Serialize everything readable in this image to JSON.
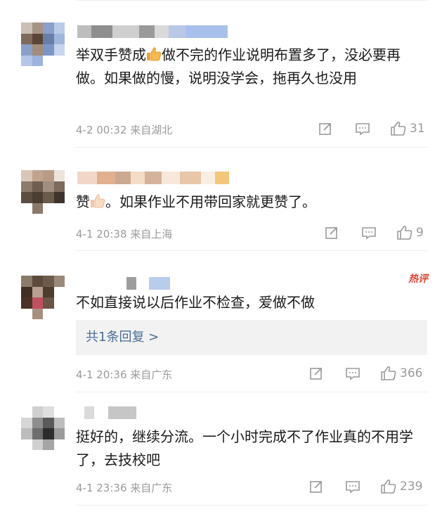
{
  "comments": [
    {
      "text": "举双手赞成👍做不完的作业说明布置多了，没必要再做。如果做的慢，说明没学会，拖再久也没用",
      "text_before": "举双手赞成",
      "text_after": "做不完的作业说明布置多了，没必要再做。如果做的慢，说明没学会，拖再久也没用",
      "time": "4-2 00:32 来自湖北",
      "likes": "31",
      "emoji": "thumbs-up-icon"
    },
    {
      "text_before": "赞",
      "text_after": "。如果作业不用带回家就更赞了。",
      "time": "4-1 20:38 来自上海",
      "likes": "9",
      "emoji": "thumbs-up-icon"
    },
    {
      "badge": "热评",
      "text": "不如直接说以后作业不检查，爱做不做",
      "reply_link": "共1条回复 >",
      "time": "4-1 20:36 来自广东",
      "likes": "366"
    },
    {
      "text": "挺好的，继续分流。一个小时完成不了作业真的不用学了，去技校吧",
      "time": "4-1 23:36 来自广东",
      "likes": "239"
    }
  ],
  "colors": {
    "text": "#1a1a1a",
    "meta": "#9a9a9a",
    "hot_badge": "#e2452f",
    "reply_link": "#4a6d9a",
    "reply_bg": "#f2f2f2"
  }
}
